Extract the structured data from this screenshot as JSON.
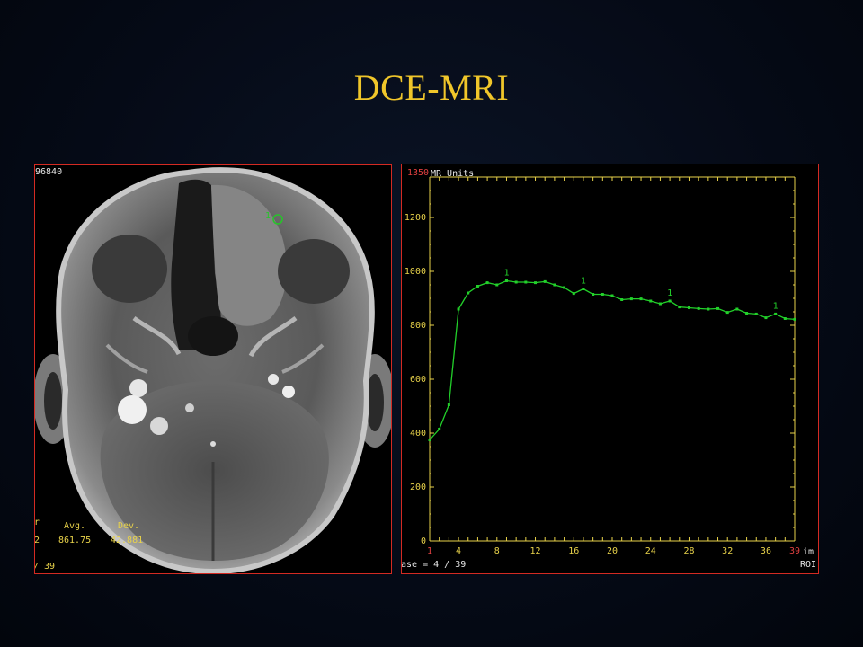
{
  "slide": {
    "title": "DCE-MRI",
    "accent_color": "#f0c62a",
    "frame_color": "#d42a22"
  },
  "mri_image": {
    "top_left_label": "96840",
    "roi_label": "1",
    "stats_label_avg": "Avg.",
    "stats_label_dev": "Dev.",
    "stats_value_avg": "861.75",
    "stats_value_dev": "42.881",
    "stats_row_prefix_1": "r",
    "stats_row_prefix_2": "2",
    "frame_counter": "/ 39",
    "roi_color": "#27c42a"
  },
  "chart_data": {
    "type": "line",
    "y_max_label": "1350",
    "y_unit_label": "MR Units",
    "x_unit_label": "im",
    "roi_footer_label": "ROI",
    "phase_label": "ase =  4 / 39",
    "ylim": [
      0,
      1350
    ],
    "xlim": [
      1,
      39
    ],
    "y_ticks": [
      0,
      200,
      400,
      600,
      800,
      1000,
      1200
    ],
    "x_ticks": [
      1,
      4,
      8,
      12,
      16,
      20,
      24,
      28,
      32,
      36,
      39
    ],
    "x_tick_colors_red": [
      1,
      39
    ],
    "series": [
      {
        "color": "#22d02a",
        "marker_label": "1",
        "marker_at": [
          9,
          17,
          26,
          37
        ],
        "x": [
          1,
          2,
          3,
          4,
          5,
          6,
          7,
          8,
          9,
          10,
          11,
          12,
          13,
          14,
          15,
          16,
          17,
          18,
          19,
          20,
          21,
          22,
          23,
          24,
          25,
          26,
          27,
          28,
          29,
          30,
          31,
          32,
          33,
          34,
          35,
          36,
          37,
          38,
          39
        ],
        "y": [
          375,
          415,
          505,
          860,
          920,
          945,
          958,
          950,
          965,
          960,
          960,
          958,
          962,
          950,
          940,
          918,
          935,
          915,
          915,
          910,
          895,
          898,
          898,
          890,
          880,
          890,
          868,
          865,
          862,
          860,
          862,
          848,
          860,
          845,
          842,
          828,
          842,
          825,
          822
        ]
      }
    ],
    "grid": false,
    "axis_color": "#e8d24a"
  }
}
